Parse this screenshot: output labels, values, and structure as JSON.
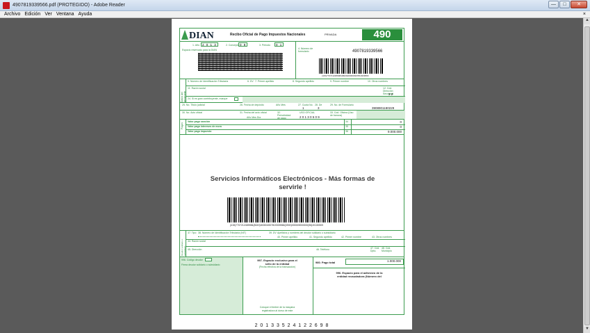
{
  "window": {
    "title": "4907819339566.pdf (PROTEGIDO) - Adobe Reader",
    "min_glyph": "—",
    "max_glyph": "□",
    "close_glyph": "✕"
  },
  "menu": {
    "items": [
      "Archivo",
      "Edición",
      "Ver",
      "Ventana",
      "Ayuda"
    ],
    "close_glyph": "×"
  },
  "scrollbar": {
    "up_glyph": "▲",
    "down_glyph": "▼"
  },
  "form": {
    "logo": "DIAN",
    "title": "Recibo Oficial de Pago Impuestos Nacionales",
    "privada": "PRIVADA",
    "form_number": "490",
    "anio_label": "1. Año",
    "anio_value": "2 0 1 3",
    "concepto_label": "2. Concepto",
    "concepto_value": "0 8",
    "periodo_label": "3. Periodo",
    "periodo_value": "0 1",
    "espacio_label": "Espacio reservado para la DIAN",
    "numero_formulario_label": "4. Número de formulario",
    "numero_formulario_value": "4907819339566",
    "barcode_caption": "(415)7707212489984(8020)000004907819339566",
    "nit_label": "5. Número de Identificación Tributaria",
    "dv_label": "6. DV",
    "apellido1_label": "7. Primer apellido",
    "apellido2_label": "8. Segundo apellido",
    "nombre1_label": "9. Primer nombre",
    "otros_nombres_label": "10. Otros nombres",
    "razon_social_label": "11. Razón social",
    "cod_direccion_label": "12. Cód. Dirección Seccional",
    "cod_direccion_value": "3  2",
    "datos_declarante": "Datos del declarante",
    "pago_cuenta_label": "24. Si es gran contribuyente, marque",
    "tipo_sujeto_label": "25. No. Título judicial",
    "fecha_deposito_label": "26. Fecha de depósito",
    "anio_mes": "Año   Mes",
    "cuotas_label": "27. Cuota No.",
    "cuota_value": "1",
    "de_label": "28. De",
    "de_value": "3",
    "numero_formulario2_label": "29. No. de Formulario",
    "numero_formulario2_value": "3908901180229",
    "acto_oficial_label": "30. No. Acto oficial",
    "fecha_acto_label": "31. Fecha del acto oficial",
    "fecha_acto_sub": "Año    Mes    Día",
    "periodo_pago_label": "32. Periodicidad de pago",
    "uso_oficial": "USO OFICIAL",
    "uso_oficial_value": "2 0 1 3 0 5 0 9",
    "cod_oficina_label": "33. Cód. Oficina (Uso de bancos)",
    "pagos_side": "Pagos",
    "pago_sancion_label": "Valor pago sanción",
    "pago_sancion_num": "34",
    "pago_sancion_value": "0",
    "pago_intereses_label": "Valor pago intereses de mora",
    "pago_intereses_num": "35",
    "pago_intereses_value": "0",
    "pago_impuesto_label": "Valor pago impuesto",
    "pago_impuesto_num": "36",
    "pago_impuesto_value": "9.000.000",
    "promo_line1": "Servicios Informáticos Electrónicos  -  Más formas de",
    "promo_line2": "servirle !",
    "barcode2_caption": "(415)7707212489984(8020)000004907819339566(3900)000009000000(96)20130509",
    "tipo_label": "37. Tipo",
    "nit2_label": "38. Número de Identificación Tributaria (NIT)",
    "dv2_label": "39. DV",
    "apellidos_label": "Apellidos y nombres del deudor solidario o subsidiario",
    "primer_apellido_label": "40. Primer apellido",
    "segundo_apellido_label": "41. Segundo apellido",
    "primer_nombre_label": "42. Primer nombre",
    "otros_nombres2_label": "43. Otros nombres",
    "razon_social2_label": "44. Razón social",
    "direccion_label": "45. Dirección",
    "telefono_label": "46. Teléfono",
    "depto_label": "47. Cód. Dpto.",
    "municipio_label": "48. Cód. Municipio",
    "deudor_side": "Deudor solidario o subsidiario",
    "codigo_deudor_label": "996. Código deudor",
    "firma_deudor_label": "Firma deudor solidario o subsidiario",
    "espacio_entidad_line1": "997. Espacio exclusivo para el",
    "espacio_entidad_line2": "sello        de la entidad",
    "espacio_entidad_line3": "(Fecha efectiva de la transacción)",
    "pago_total_label": "980. Pago total",
    "pago_total_value": "1.000.000",
    "adhesivo_line1": "996. Espacio para el adhesivo de la",
    "adhesivo_line2": "entidad recaudadora (Número del",
    "coloque_line1": "Coloque el timbre de la máquina",
    "coloque_line2": "registradora al dorso de este",
    "bottom_number": "2 0 1 3 3 5 2 4 1 2 2 6 9 8"
  }
}
